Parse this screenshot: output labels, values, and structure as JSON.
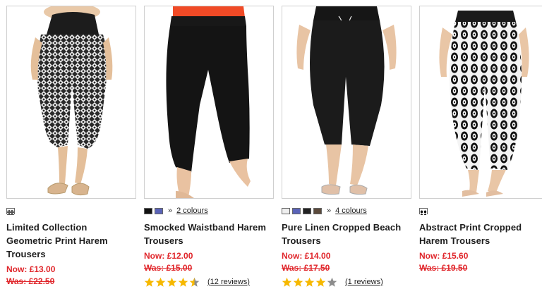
{
  "colors": {
    "price": "#e0262b",
    "star_full": "#f6b800",
    "star_empty": "#8c8c8c"
  },
  "products": [
    {
      "title": "Limited Collection Geometric Print Harem Trousers",
      "title_lines": [
        "Limited Collection",
        "Geometric Print Harem",
        "Trousers"
      ],
      "now_price": "Now: £13.00",
      "was_price": "Was: £22.50",
      "swatches": [
        "geometric-print"
      ],
      "colours_link": "",
      "rating": null,
      "reviews": ""
    },
    {
      "title": "Smocked Waistband Harem Trousers",
      "title_lines": [
        "Smocked Waistband Harem",
        "Trousers"
      ],
      "now_price": "Now: £12.00",
      "was_price": "Was: £15.00",
      "swatches": [
        "#111111",
        "#5a63b8"
      ],
      "colours_link": "2 colours",
      "rating": 4.5,
      "reviews": "(12 reviews)"
    },
    {
      "title": "Pure Linen Cropped Beach Trousers",
      "title_lines": [
        "Pure Linen Cropped Beach",
        "Trousers"
      ],
      "now_price": "Now: £14.00",
      "was_price": "Was: £17.50",
      "swatches": [
        "#efefef",
        "#5a63b8",
        "#222222",
        "#5b4a3c"
      ],
      "colours_link": "4 colours",
      "rating": 4,
      "reviews": "(1 reviews)"
    },
    {
      "title": "Abstract Print Cropped Harem Trousers",
      "title_lines": [
        "Abstract Print Cropped",
        "Harem Trousers"
      ],
      "now_price": "Now: £15.60",
      "was_price": "Was: £19.50",
      "swatches": [
        "abstract-print"
      ],
      "colours_link": "",
      "rating": null,
      "reviews": ""
    }
  ]
}
